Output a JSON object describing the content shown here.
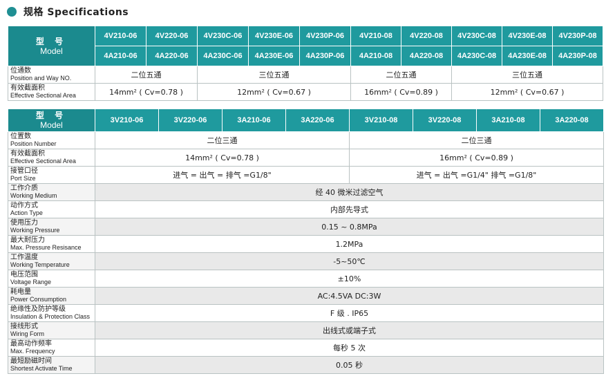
{
  "header": {
    "title": "规格 Specifications"
  },
  "table1": {
    "model_zh": "型 号",
    "model_en": "Model",
    "models_top": [
      "4V210-06",
      "4V220-06",
      "4V230C-06",
      "4V230E-06",
      "4V230P-06",
      "4V210-08",
      "4V220-08",
      "4V230C-08",
      "4V230E-08",
      "4V230P-08"
    ],
    "models_bottom": [
      "4A210-06",
      "4A220-06",
      "4A230C-06",
      "4A230E-06",
      "4A230P-06",
      "4A210-08",
      "4A220-08",
      "4A230C-08",
      "4A230E-08",
      "4A230P-08"
    ],
    "position_zh": "位通数",
    "position_en": "Position and Way NO.",
    "position_vals": [
      "二位五通",
      "三位五通",
      "二位五通",
      "三位五通"
    ],
    "area_zh": "有效截面积",
    "area_en": "Effective Sectional Area",
    "area_vals": [
      "14mm² ( Cv=0.78 )",
      "12mm² ( Cv=0.67 )",
      "16mm² ( Cv=0.89 )",
      "12mm² ( Cv=0.67 )"
    ]
  },
  "table2": {
    "model_zh": "型 号",
    "model_en": "Model",
    "models": [
      "3V210-06",
      "3V220-06",
      "3A210-06",
      "3A220-06",
      "3V210-08",
      "3V220-08",
      "3A210-08",
      "3A220-08"
    ],
    "position_zh": "位置数",
    "position_en": "Position Number",
    "position_vals": [
      "二位三通",
      "二位三通"
    ],
    "area_zh": "有效截面积",
    "area_en": "Effective Sectional Area",
    "area_vals": [
      "14mm² ( Cv=0.78 )",
      "16mm² ( Cv=0.89 )"
    ],
    "port_zh": "接管口径",
    "port_en": "Port Size",
    "port_vals": [
      "进气 = 出气 = 排气 =G1/8\"",
      "进气 = 出气 =G1/4\"   排气 =G1/8\""
    ],
    "rows": [
      {
        "zh": "工作介质",
        "en": "Working Medium",
        "value": "经 40 微米过滤空气"
      },
      {
        "zh": "动作方式",
        "en": "Action Type",
        "value": "内部先导式"
      },
      {
        "zh": "使用压力",
        "en": "Working Pressure",
        "value": "0.15 ~ 0.8MPa"
      },
      {
        "zh": "最大耐压力",
        "en": "Max. Pressure Resisance",
        "value": "1.2MPa"
      },
      {
        "zh": "工作温度",
        "en": "Working Temperature",
        "value": "-5~50℃"
      },
      {
        "zh": "电压范围",
        "en": "Voltage Range",
        "value": "±10%"
      },
      {
        "zh": "耗电量",
        "en": "Power Consumption",
        "value": "AC:4.5VA   DC:3W"
      },
      {
        "zh": "绝缘性及防护等级",
        "en": "Insulation & Protection Class",
        "value": "F 级 . IP65"
      },
      {
        "zh": "接线形式",
        "en": "Wiring Form",
        "value": "出线式或端子式"
      },
      {
        "zh": "最高动作频率",
        "en": "Max. Frequency",
        "value": "每秒 5 次"
      },
      {
        "zh": "最短励磁时间",
        "en": "Shortest Activate Time",
        "value": "0.05 秒"
      }
    ]
  },
  "colors": {
    "accent": "#1f9a9e",
    "model_cell": "#1b8a8e",
    "dot": "#1f8f93"
  }
}
